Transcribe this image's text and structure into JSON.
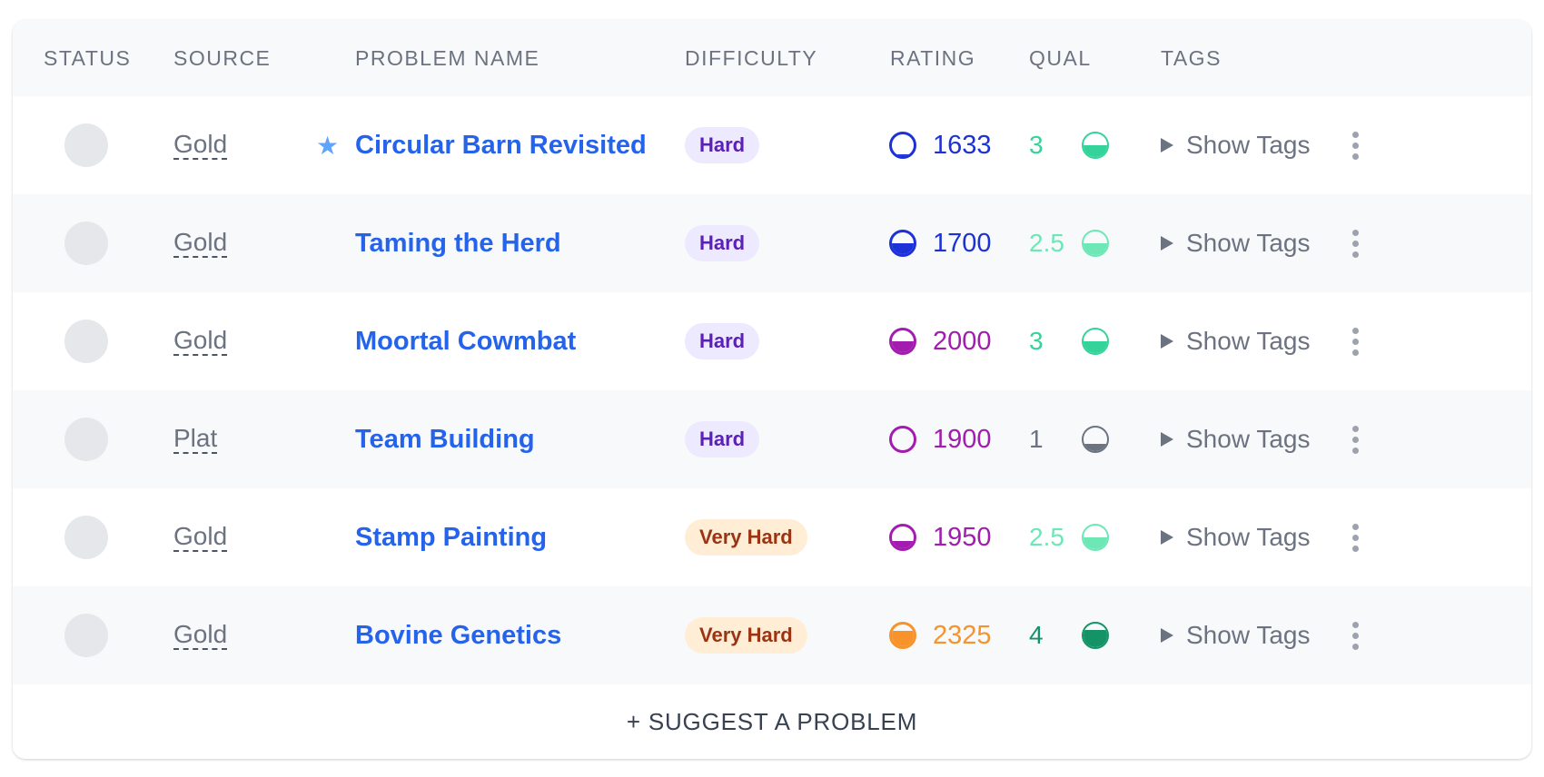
{
  "headers": {
    "status": "STATUS",
    "source": "SOURCE",
    "problem_name": "PROBLEM NAME",
    "difficulty": "DIFFICULTY",
    "rating": "RATING",
    "qual": "QUAL",
    "tags": "TAGS"
  },
  "rows": [
    {
      "source": "Gold",
      "starred": true,
      "name": "Circular Barn Revisited",
      "difficulty": "Hard",
      "difficulty_kind": "hard",
      "rating": "1633",
      "rating_color": "#1d31d8",
      "rating_fill": 0.1,
      "qual": "3",
      "qual_color": "#34d399",
      "qual_fill": 0.5
    },
    {
      "source": "Gold",
      "starred": false,
      "name": "Taming the Herd",
      "difficulty": "Hard",
      "difficulty_kind": "hard",
      "rating": "1700",
      "rating_color": "#1d31d8",
      "rating_fill": 0.5,
      "qual": "2.5",
      "qual_color": "#6ee7b7",
      "qual_fill": 0.5
    },
    {
      "source": "Gold",
      "starred": false,
      "name": "Moortal Cowmbat",
      "difficulty": "Hard",
      "difficulty_kind": "hard",
      "rating": "2000",
      "rating_color": "#a21caf",
      "rating_fill": 0.5,
      "qual": "3",
      "qual_color": "#34d399",
      "qual_fill": 0.5
    },
    {
      "source": "Plat",
      "starred": false,
      "name": "Team Building",
      "difficulty": "Hard",
      "difficulty_kind": "hard",
      "rating": "1900",
      "rating_color": "#a21caf",
      "rating_fill": 0.0,
      "qual": "1",
      "qual_color": "#6b7280",
      "qual_fill": 0.3
    },
    {
      "source": "Gold",
      "starred": false,
      "name": "Stamp Painting",
      "difficulty": "Very Hard",
      "difficulty_kind": "vhard",
      "rating": "1950",
      "rating_color": "#a21caf",
      "rating_fill": 0.35,
      "qual": "2.5",
      "qual_color": "#6ee7b7",
      "qual_fill": 0.5
    },
    {
      "source": "Gold",
      "starred": false,
      "name": "Bovine Genetics",
      "difficulty": "Very Hard",
      "difficulty_kind": "vhard",
      "rating": "2325",
      "rating_color": "#f7932a",
      "rating_fill": 0.7,
      "qual": "4",
      "qual_color": "#149466",
      "qual_fill": 0.75
    }
  ],
  "show_tags_label": "Show Tags",
  "star_icon": "star-icon",
  "expand_icon": "triangle-right-icon",
  "menu_icon": "kebab-menu-icon",
  "footer": {
    "suggest_label": "+ SUGGEST A PROBLEM"
  }
}
